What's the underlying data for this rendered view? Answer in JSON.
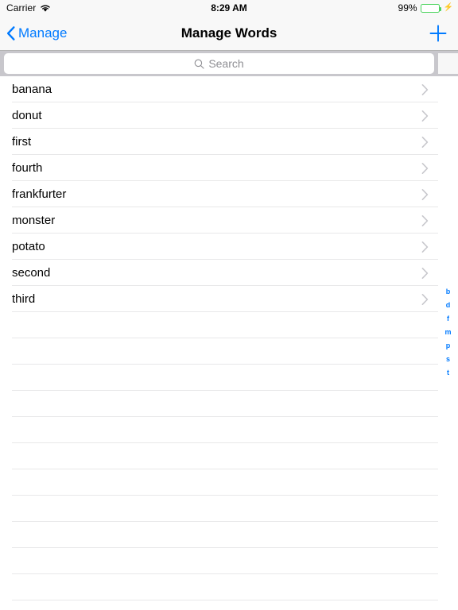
{
  "status_bar": {
    "carrier": "Carrier",
    "wifi_icon": "wifi-icon",
    "time": "8:29 AM",
    "battery_percent": "99%",
    "battery_level": 99,
    "battery_icon": "battery-icon",
    "charging_icon": "lightning-bolt-icon"
  },
  "nav_bar": {
    "back_label": "Manage",
    "back_icon": "chevron-left-icon",
    "title": "Manage Words",
    "add_icon": "plus-icon",
    "accent_color": "#007aff"
  },
  "search": {
    "placeholder": "Search",
    "value": "",
    "icon": "search-icon"
  },
  "list": {
    "disclosure_icon": "chevron-right-icon",
    "items": [
      {
        "label": "banana"
      },
      {
        "label": "donut"
      },
      {
        "label": "first"
      },
      {
        "label": "fourth"
      },
      {
        "label": "frankfurter"
      },
      {
        "label": "monster"
      },
      {
        "label": "potato"
      },
      {
        "label": "second"
      },
      {
        "label": "third"
      }
    ],
    "empty_row_count": 11
  },
  "section_index": {
    "letters": [
      "b",
      "d",
      "f",
      "m",
      "p",
      "s",
      "t"
    ],
    "color": "#007aff"
  }
}
